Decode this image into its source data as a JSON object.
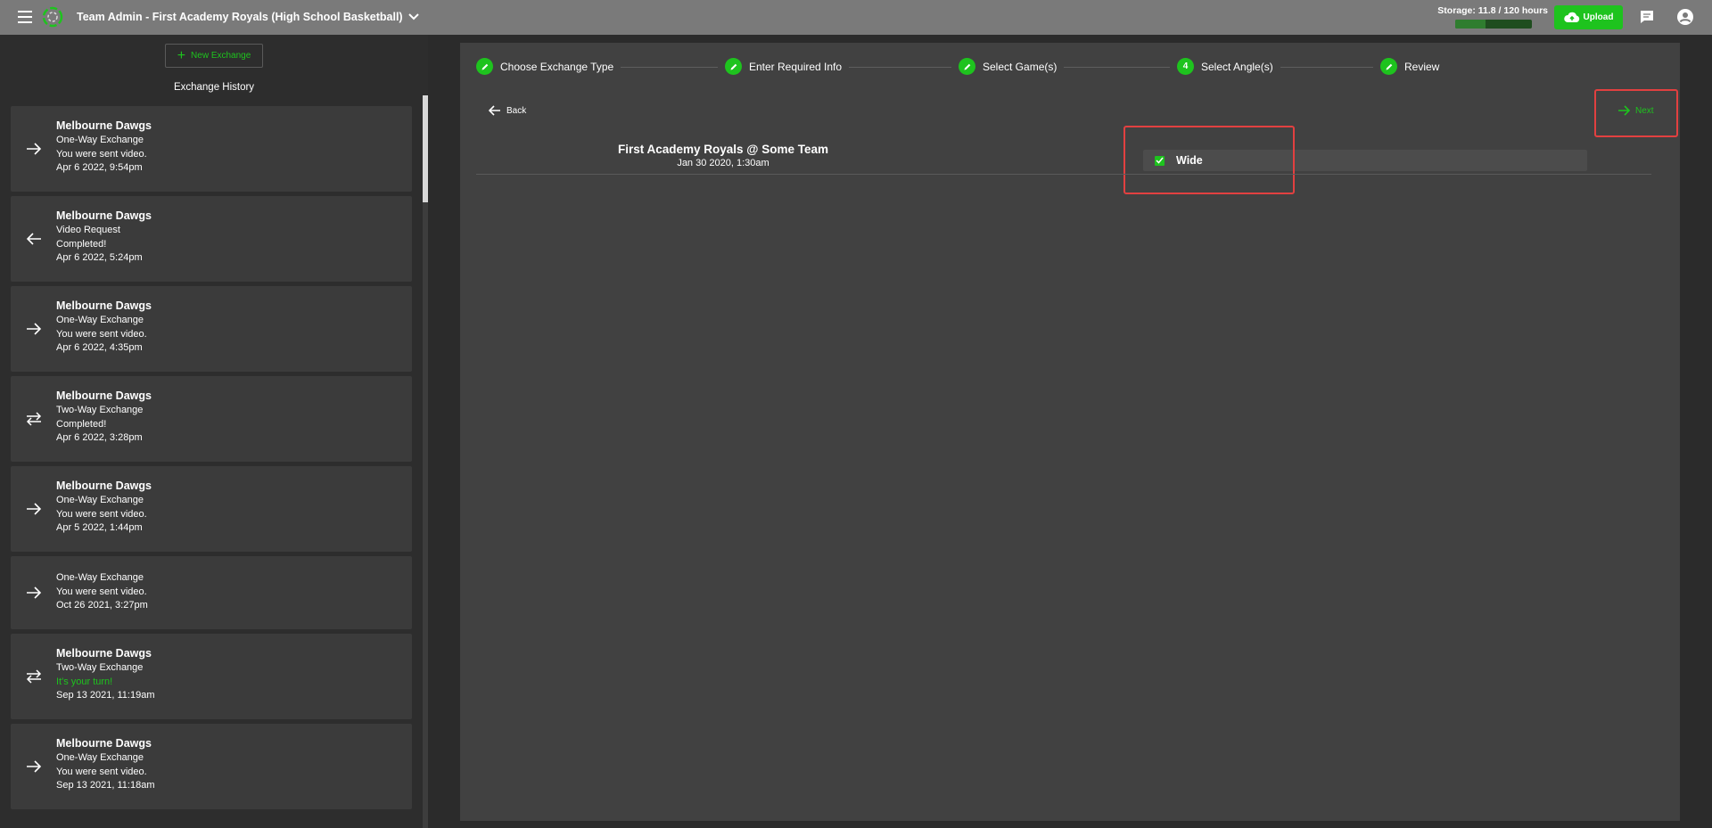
{
  "header": {
    "title": "Team Admin - First Academy Royals (High School Basketball)",
    "storage_label": "Storage: 11.8 / 120 hours",
    "storage_fraction": 0.098,
    "upload_label": "Upload"
  },
  "sidebar": {
    "new_exchange_label": "New Exchange",
    "history_title": "Exchange History",
    "items": [
      {
        "direction": "right",
        "team": "Melbourne Dawgs",
        "type": "One-Way Exchange",
        "status": "You were sent video.",
        "date": "Apr 6 2022, 9:54pm"
      },
      {
        "direction": "left",
        "team": "Melbourne Dawgs",
        "type": "Video Request",
        "status": "Completed!",
        "date": "Apr 6 2022, 5:24pm"
      },
      {
        "direction": "right",
        "team": "Melbourne Dawgs",
        "type": "One-Way Exchange",
        "status": "You were sent video.",
        "date": "Apr 6 2022, 4:35pm"
      },
      {
        "direction": "both",
        "team": "Melbourne Dawgs",
        "type": "Two-Way Exchange",
        "status": "Completed!",
        "date": "Apr 6 2022, 3:28pm"
      },
      {
        "direction": "right",
        "team": "Melbourne Dawgs",
        "type": "One-Way Exchange",
        "status": "You were sent video.",
        "date": "Apr 5 2022, 1:44pm"
      },
      {
        "direction": "right",
        "team": "",
        "type": "One-Way Exchange",
        "status": "You were sent video.",
        "date": "Oct 26 2021, 3:27pm"
      },
      {
        "direction": "both",
        "team": "Melbourne Dawgs",
        "type": "Two-Way Exchange",
        "status": "It's your turn!",
        "status_highlight": true,
        "date": "Sep 13 2021, 11:19am"
      },
      {
        "direction": "right",
        "team": "Melbourne Dawgs",
        "type": "One-Way Exchange",
        "status": "You were sent video.",
        "date": "Sep 13 2021, 11:18am"
      }
    ]
  },
  "steps": [
    {
      "label": "Choose Exchange Type",
      "badge": "edit"
    },
    {
      "label": "Enter Required Info",
      "badge": "edit"
    },
    {
      "label": "Select Game(s)",
      "badge": "edit"
    },
    {
      "label": "Select Angle(s)",
      "badge": "4"
    },
    {
      "label": "Review",
      "badge": "edit"
    }
  ],
  "nav": {
    "back_label": "Back",
    "next_label": "Next"
  },
  "game": {
    "title": "First Academy Royals @ Some Team",
    "date": "Jan 30 2020, 1:30am"
  },
  "angles": [
    {
      "label": "Wide",
      "checked": true
    }
  ],
  "colors": {
    "accent": "#1ec31e",
    "highlight": "#e24040"
  }
}
